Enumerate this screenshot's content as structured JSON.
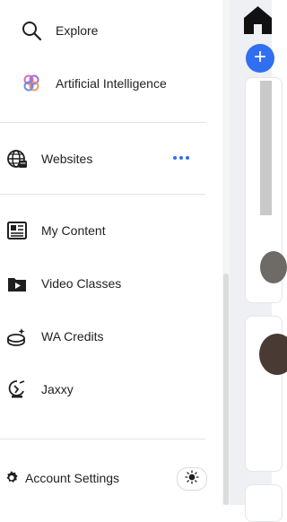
{
  "nav": {
    "explore": "Explore",
    "ai": "Artificial Intelligence",
    "websites": "Websites",
    "my_content": "My Content",
    "video_classes": "Video Classes",
    "wa_credits": "WA Credits",
    "jaxxy": "Jaxxy"
  },
  "footer": {
    "account_settings": "Account Settings"
  },
  "icons": {
    "explore": "search-icon",
    "ai": "brain-icon",
    "websites": "globe-icon",
    "more": "more-dots-icon",
    "my_content": "newspaper-icon",
    "video_classes": "video-folder-icon",
    "wa_credits": "credits-coins-icon",
    "jaxxy": "jaxxy-icon",
    "settings": "gear-icon",
    "theme": "sun-icon",
    "home": "home-icon",
    "add": "plus-icon"
  },
  "colors": {
    "accent": "#2f6ff0",
    "divider": "#e3e3e3",
    "panel_bg": "#eef0f3"
  },
  "right_panel": {
    "add_label": "+"
  }
}
